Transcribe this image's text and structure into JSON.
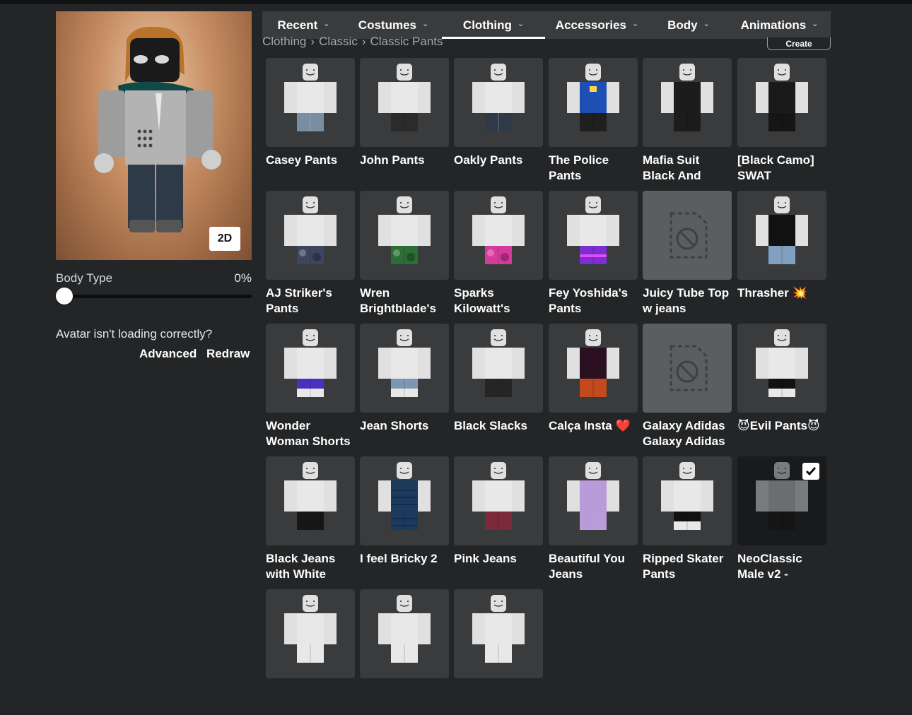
{
  "avatar": {
    "toggle_2d_label": "2D"
  },
  "body_type": {
    "label": "Body Type",
    "value": "0%",
    "fraction": 0.0
  },
  "help": {
    "text": "Avatar isn't loading correctly?",
    "advanced": "Advanced",
    "redraw": "Redraw"
  },
  "tabs": [
    {
      "label": "Recent",
      "active": false
    },
    {
      "label": "Costumes",
      "active": false
    },
    {
      "label": "Clothing",
      "active": true
    },
    {
      "label": "Accessories",
      "active": false
    },
    {
      "label": "Body",
      "active": false
    },
    {
      "label": "Animations",
      "active": false
    }
  ],
  "breadcrumb": [
    "Clothing",
    "Classic",
    "Classic Pants"
  ],
  "create_label": "Create",
  "items": [
    {
      "name": "Casey Pants",
      "pants": "#7a8ea3",
      "torso": "#e8e8e8",
      "style": "jeans"
    },
    {
      "name": "John Pants",
      "pants": "#2b2b2b",
      "torso": "#e8e8e8",
      "style": "plain"
    },
    {
      "name": "Oakly Pants",
      "pants": "#2e3a48",
      "torso": "#e8e8e8",
      "style": "jeans"
    },
    {
      "name": "The Police Pants",
      "pants": "#1f1f1f",
      "torso": "#1d4fb5",
      "style": "uniform"
    },
    {
      "name": "Mafia Suit Black And",
      "pants": "#1c1c1c",
      "torso": "#1c1c1c",
      "style": "suit"
    },
    {
      "name": "[Black Camo] SWAT",
      "pants": "#151515",
      "torso": "#1a1a1a",
      "style": "suit"
    },
    {
      "name": "AJ Striker's Pants",
      "pants": "#3d4560",
      "torso": "#e8e8e8",
      "style": "camo"
    },
    {
      "name": "Wren Brightblade's",
      "pants": "#2c6e35",
      "torso": "#e8e8e8",
      "style": "camo"
    },
    {
      "name": "Sparks Kilowatt's",
      "pants": "#d63a9a",
      "torso": "#e8e8e8",
      "style": "camo"
    },
    {
      "name": "Fey Yoshida's Pants",
      "pants": "#7b2fd1",
      "torso": "#e8e8e8",
      "style": "glow"
    },
    {
      "name": "Juicy Tube Top w jeans",
      "empty": true
    },
    {
      "name": "Thrasher 💥",
      "pants": "#7fa0c0",
      "torso": "#111111",
      "style": "tank"
    },
    {
      "name": "Wonder Woman Shorts",
      "pants": "#4b2fbf",
      "torso": "#e8e8e8",
      "style": "shorts"
    },
    {
      "name": "Jean Shorts",
      "pants": "#7d97b3",
      "torso": "#e8e8e8",
      "style": "shorts"
    },
    {
      "name": "Black Slacks",
      "pants": "#252525",
      "torso": "#e8e8e8",
      "style": "plain"
    },
    {
      "name": "Calça Insta ❤️",
      "pants": "#c24a1e",
      "torso": "#2a1020",
      "style": "suit"
    },
    {
      "name": "Galaxy Adidas Galaxy Adidas",
      "empty": true
    },
    {
      "name": "😈Evil Pants😈",
      "pants": "#111111",
      "torso": "#e8e8e8",
      "style": "shorts"
    },
    {
      "name": "Black Jeans with White",
      "pants": "#161616",
      "torso": "#e8e8e8",
      "style": "plain"
    },
    {
      "name": "I feel Bricky 2",
      "pants": "#1c3a5e",
      "torso": "#1c3a5e",
      "style": "brick"
    },
    {
      "name": "Pink Jeans",
      "pants": "#7a2a3a",
      "torso": "#e8e8e8",
      "style": "plain"
    },
    {
      "name": "Beautiful You Jeans",
      "pants": "#b89bd8",
      "torso": "#b89bd8",
      "style": "jeans"
    },
    {
      "name": "Ripped Skater Pants",
      "pants": "#111111",
      "torso": "#e8e8e8",
      "style": "shorts"
    },
    {
      "name": "NeoClassic Male v2 -",
      "pants": "#151515",
      "torso": "#6c6d6e",
      "style": "plain",
      "selected": true
    },
    {
      "name": "",
      "pants": "#e8e8e8",
      "torso": "#e8e8e8",
      "style": "plain"
    },
    {
      "name": "",
      "pants": "#e8e8e8",
      "torso": "#e8e8e8",
      "style": "plain"
    },
    {
      "name": "",
      "pants": "#e8e8e8",
      "torso": "#e8e8e8",
      "style": "plain"
    }
  ]
}
